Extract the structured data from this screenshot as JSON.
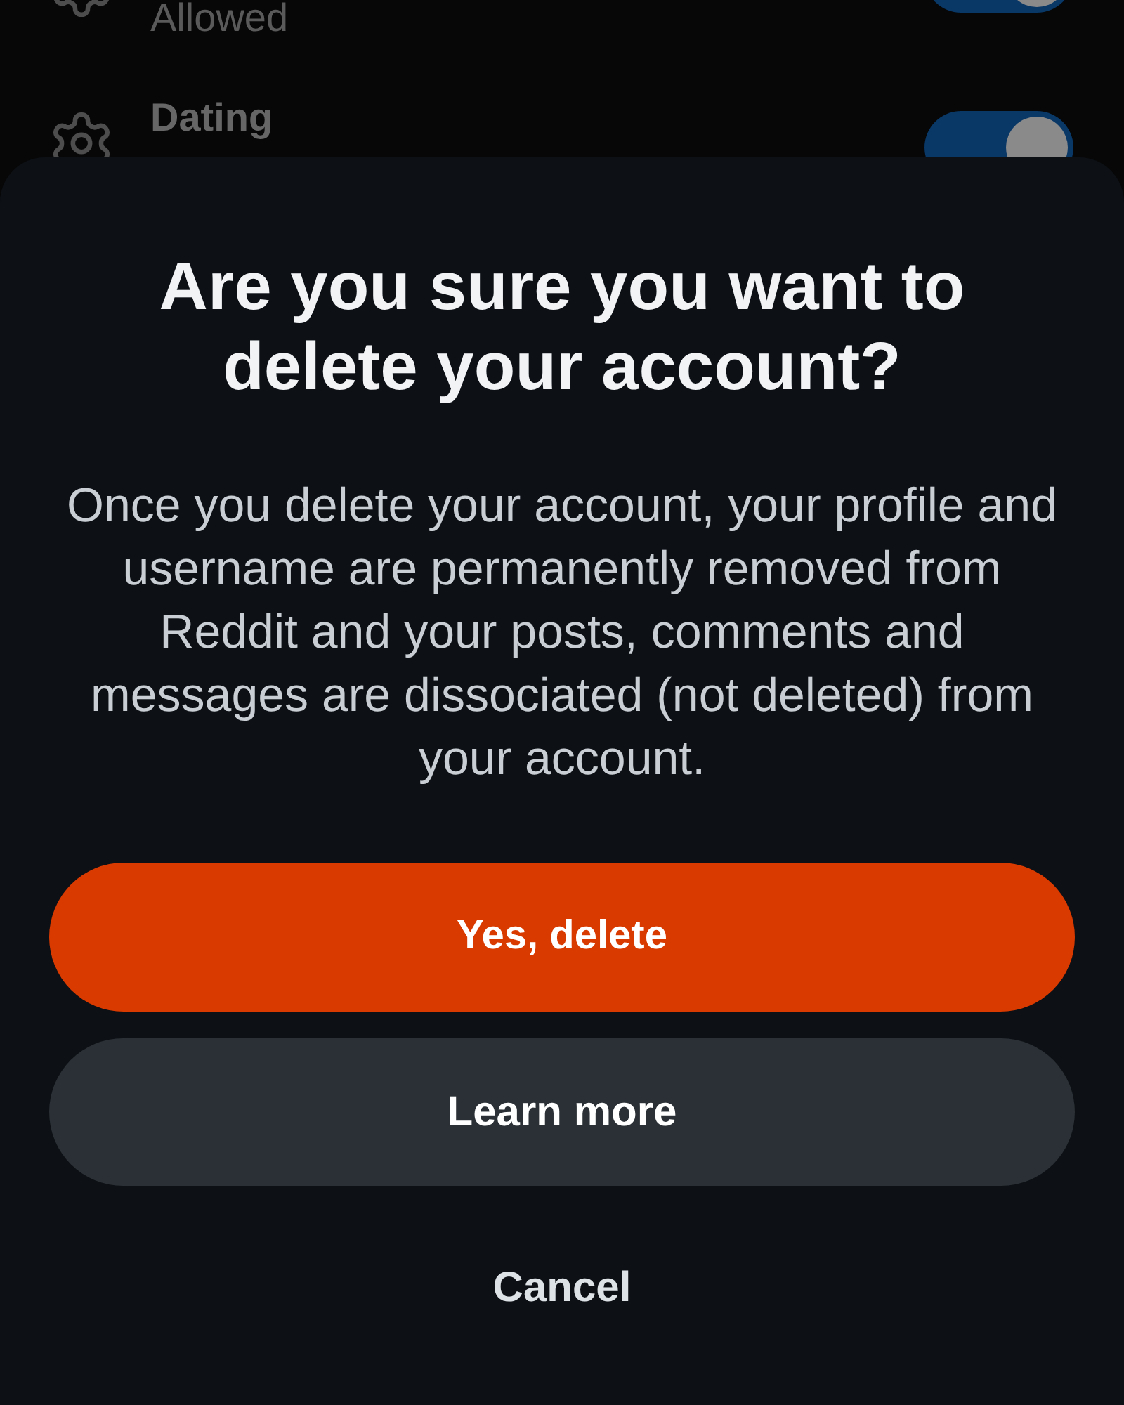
{
  "settings": [
    {
      "subtitle": "Allowed",
      "on": true
    },
    {
      "title": "Dating",
      "on": true
    }
  ],
  "dialog": {
    "title": "Are you sure you want to delete your account?",
    "message": "Once you delete your account, your profile and username are permanently removed from Reddit and your posts, comments and messages are dissociated (not deleted) from your account.",
    "buttons": [
      {
        "label": "Yes, delete",
        "kind": "primary"
      },
      {
        "label": "Learn more",
        "kind": "secondary"
      },
      {
        "label": "Cancel",
        "kind": "text"
      }
    ]
  }
}
